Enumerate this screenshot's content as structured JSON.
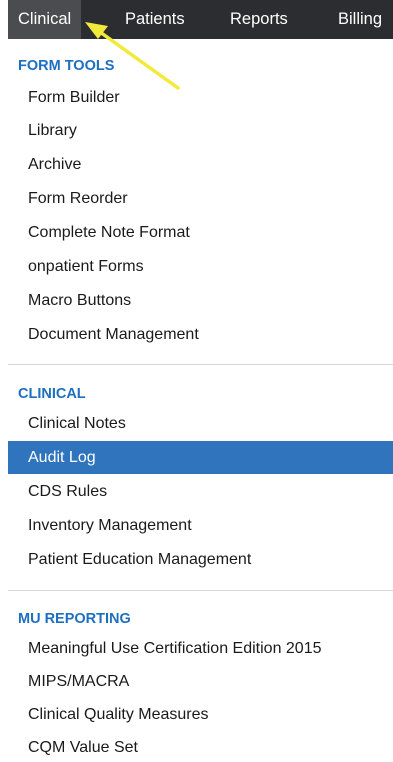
{
  "nav": {
    "items": [
      {
        "label": "Clinical"
      },
      {
        "label": "Patients"
      },
      {
        "label": "Reports"
      },
      {
        "label": "Billing"
      }
    ]
  },
  "sections": [
    {
      "title": "FORM TOOLS",
      "items": [
        {
          "label": "Form Builder"
        },
        {
          "label": "Library"
        },
        {
          "label": "Archive"
        },
        {
          "label": "Form Reorder"
        },
        {
          "label": "Complete Note Format"
        },
        {
          "label": "onpatient Forms"
        },
        {
          "label": "Macro Buttons"
        },
        {
          "label": "Document Management"
        }
      ]
    },
    {
      "title": "CLINICAL",
      "items": [
        {
          "label": "Clinical Notes"
        },
        {
          "label": "Audit Log",
          "selected": true
        },
        {
          "label": "CDS Rules"
        },
        {
          "label": "Inventory Management"
        },
        {
          "label": "Patient Education Management"
        }
      ]
    },
    {
      "title": "MU REPORTING",
      "items": [
        {
          "label": "Meaningful Use Certification Edition 2015"
        },
        {
          "label": "MIPS/MACRA"
        },
        {
          "label": "Clinical Quality Measures"
        },
        {
          "label": "CQM Value Set"
        }
      ]
    }
  ],
  "colors": {
    "nav_background": "#2b2d30",
    "section_title": "#1d6fc2",
    "selected_background": "#2f74bd",
    "annotation_arrow": "#f2ea3a"
  },
  "annotation": {
    "icon": "arrow-icon"
  }
}
